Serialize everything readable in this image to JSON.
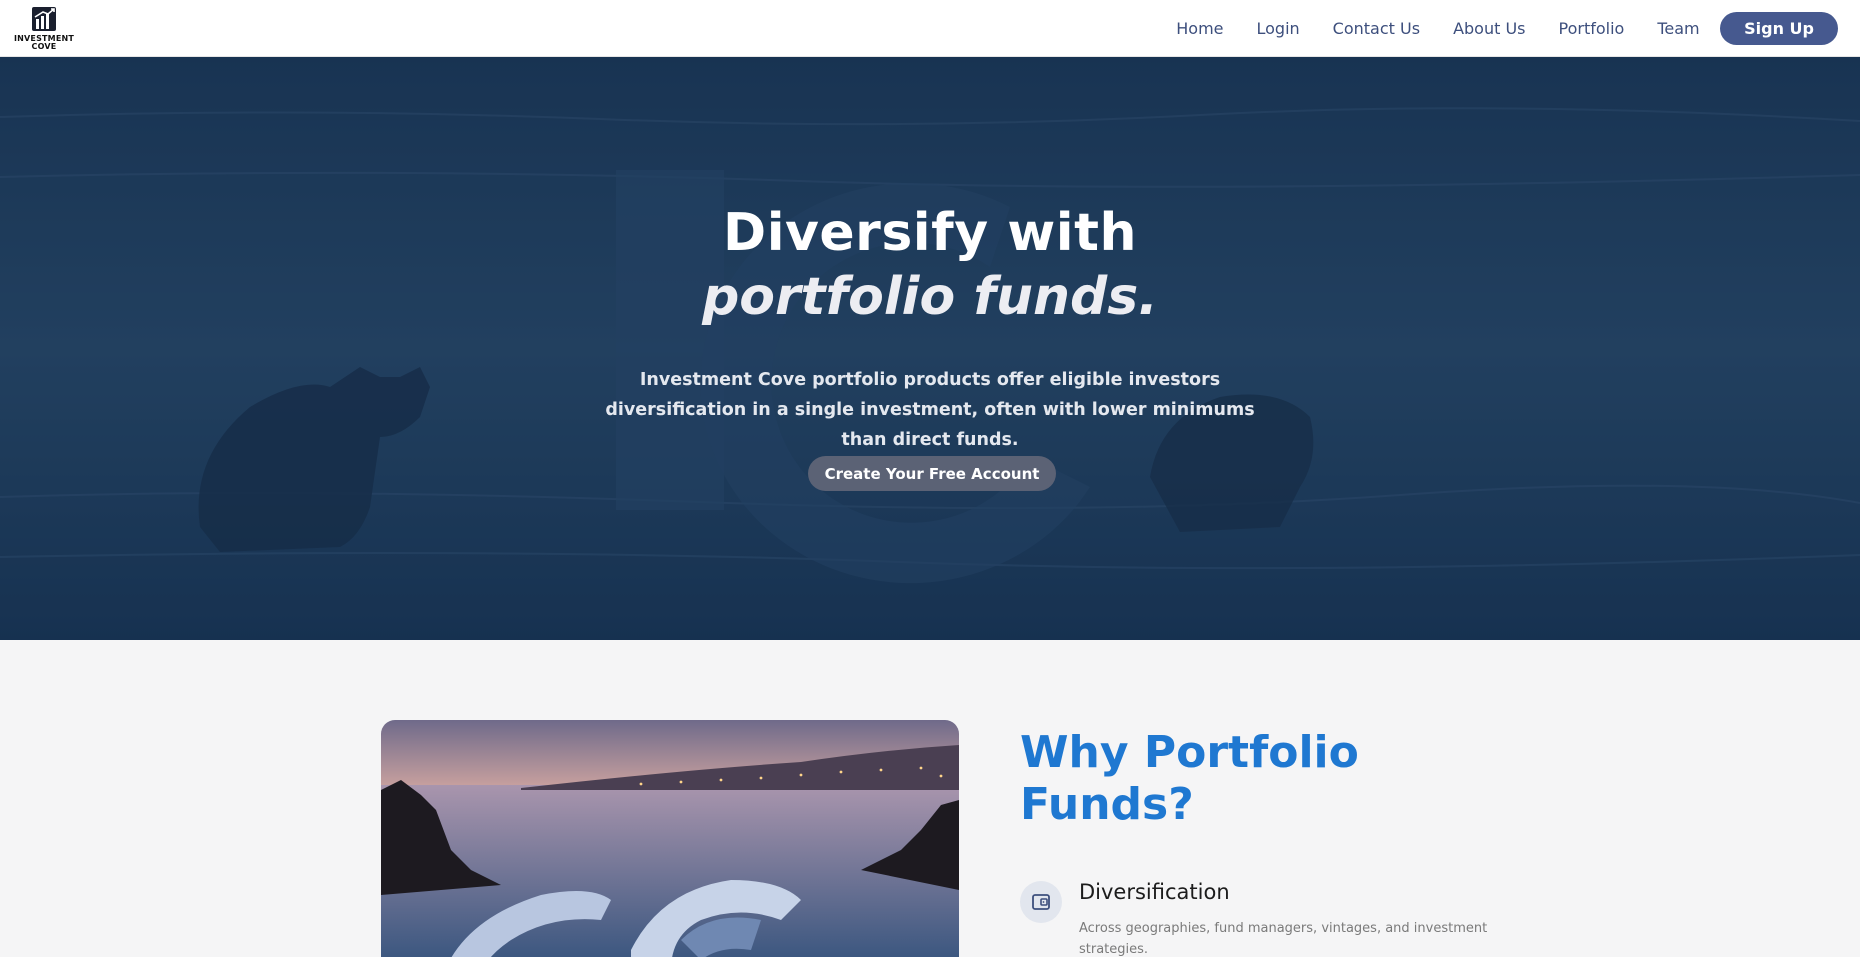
{
  "brand": {
    "logo_text_line1": "INVESTMENT",
    "logo_text_line2": "COVE"
  },
  "nav": {
    "items": [
      {
        "label": "Home"
      },
      {
        "label": "Login"
      },
      {
        "label": "Contact Us"
      },
      {
        "label": "About Us"
      },
      {
        "label": "Portfolio"
      },
      {
        "label": "Team"
      }
    ],
    "signup_label": "Sign Up"
  },
  "hero": {
    "title_line1": "Diversify with",
    "title_line2": "portfolio funds.",
    "subtitle": "Investment Cove portfolio products offer eligible investors diversification in a single investment, often with lower minimums than direct funds.",
    "cta_label": "Create Your Free Account"
  },
  "why": {
    "title_line1": "Why Portfolio",
    "title_line2": "Funds?",
    "features": [
      {
        "icon": "wallet-icon",
        "title": "Diversification",
        "description": "Across geographies, fund managers, vintages, and investment strategies."
      }
    ]
  },
  "colors": {
    "nav_text": "#3d4f7d",
    "signup_bg": "#46598f",
    "accent_blue": "#1f78d1",
    "hero_bg": "#1f3a58",
    "cta_bg": "#5b6275",
    "page_bg": "#f5f5f6"
  }
}
